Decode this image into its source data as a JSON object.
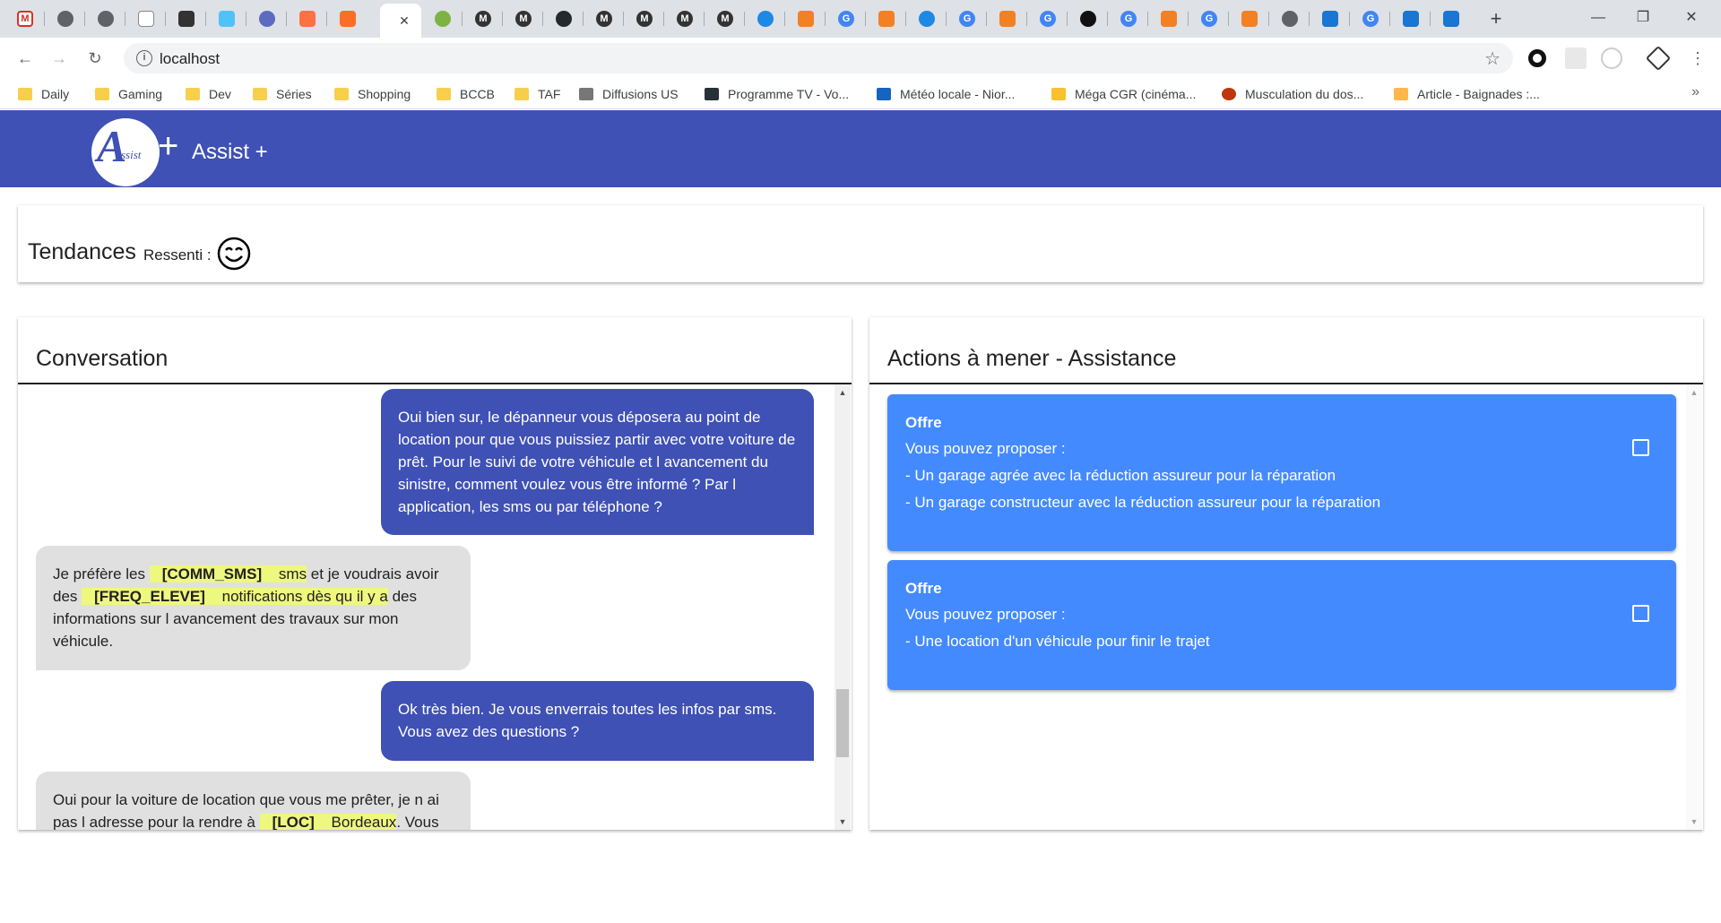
{
  "browser": {
    "active_tab_close": "✕",
    "new_tab": "+",
    "window_controls": [
      "—",
      "❐",
      "✕"
    ],
    "url": "localhost",
    "bookmarks": [
      {
        "label": "Daily",
        "icon": "folder-icon"
      },
      {
        "label": "Gaming",
        "icon": "folder-icon"
      },
      {
        "label": "Dev",
        "icon": "folder-icon"
      },
      {
        "label": "Séries",
        "icon": "folder-icon"
      },
      {
        "label": "Shopping",
        "icon": "folder-icon"
      },
      {
        "label": "BCCB",
        "icon": "folder-icon"
      },
      {
        "label": "TAF",
        "icon": "folder-icon"
      },
      {
        "label": "Diffusions US",
        "icon": "grid-icon"
      },
      {
        "label": "Programme TV - Vo...",
        "icon": "tv-icon"
      },
      {
        "label": "Météo locale - Nior...",
        "icon": "weather-icon"
      },
      {
        "label": "Méga CGR (cinéma...",
        "icon": "cinema-icon"
      },
      {
        "label": "Musculation du dos...",
        "icon": "sunset-icon"
      },
      {
        "label": "Article - Baignades :...",
        "icon": "can-icon"
      }
    ],
    "bookmarks_more": "»"
  },
  "app": {
    "logo_letter": "A",
    "logo_small": "ssist",
    "logo_plus": "+",
    "title": "Assist +"
  },
  "trends": {
    "title": "Tendances",
    "ressenti_label": "Ressenti :",
    "ressenti_icon": "smiling-face-icon"
  },
  "conversation": {
    "title": "Conversation",
    "messages": [
      {
        "from": "agent",
        "text": "Oui bien sur, le dépanneur vous déposera au point de location pour que vous puissiez partir avec votre voiture de prêt. Pour le suivi de votre véhicule et l avancement du sinistre, comment voulez vous être informé ? Par l application, les sms ou par téléphone ?"
      },
      {
        "from": "client",
        "parts": [
          "Je préfère les ",
          "[COMM_SMS]",
          " sms",
          " et je voudrais avoir des ",
          "[FREQ_ELEVE]",
          " notifications dès qu il y a",
          " des informations sur l avancement des travaux sur mon véhicule."
        ]
      },
      {
        "from": "agent",
        "text": "Ok très bien. Je vous enverrais toutes les infos par sms. Vous avez des questions ?"
      },
      {
        "from": "client",
        "parts": [
          "Oui pour la voiture de location que vous me prêter, je n ai pas l adresse pour la rendre à ",
          "[LOC]",
          " Bordeaux",
          ". Vous"
        ]
      }
    ],
    "scroll_up": "▲",
    "scroll_down": "▼"
  },
  "actions": {
    "title": "Actions à mener - Assistance",
    "offers": [
      {
        "title": "Offre",
        "lines": [
          "Vous pouvez proposer :",
          "- Un garage agrée avec la réduction assureur pour la réparation",
          "- Un garage constructeur avec la réduction assureur pour la réparation"
        ],
        "checked": false
      },
      {
        "title": "Offre",
        "lines": [
          "Vous pouvez proposer :",
          "- Une location d'un véhicule pour finir le trajet"
        ],
        "checked": false
      }
    ],
    "scroll_up": "▲",
    "scroll_down": "▼"
  },
  "colors": {
    "appbar": "#3f51b5",
    "agent_bubble": "#3f51b5",
    "client_bubble": "#e0e0e0",
    "highlight": "#eef77e",
    "offer_card": "#448aff"
  }
}
